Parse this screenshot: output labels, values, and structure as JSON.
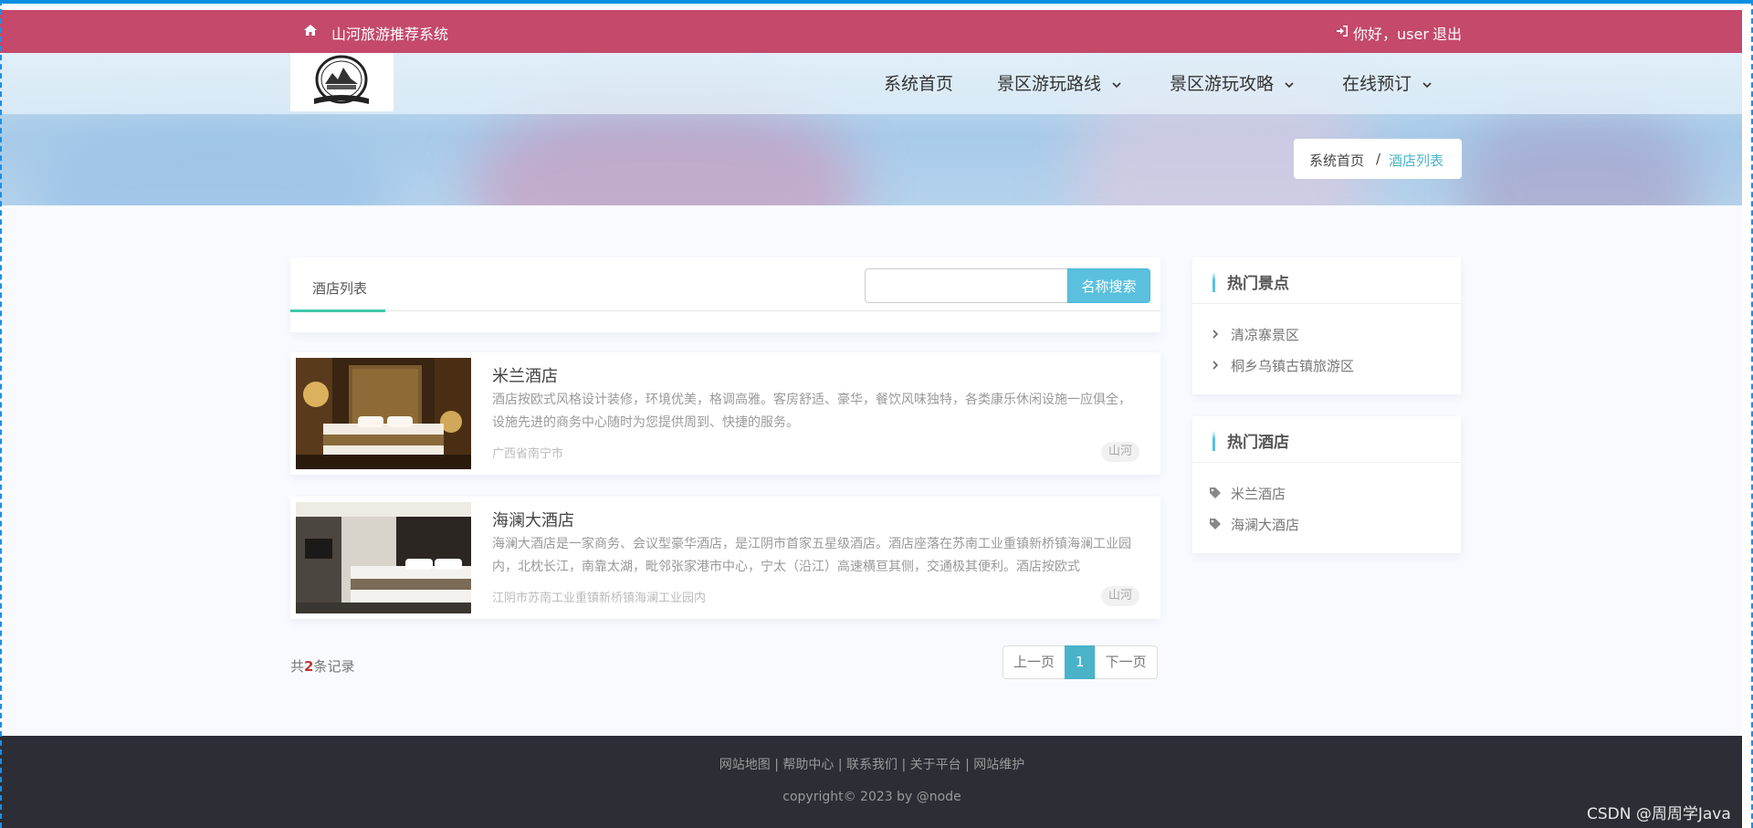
{
  "topbar": {
    "site_name": "山河旅游推荐系统",
    "greeting": "你好，user",
    "logout": "退出",
    "bg_color": "#c4496b"
  },
  "nav": {
    "items": [
      {
        "label": "系统首页",
        "has_dropdown": false
      },
      {
        "label": "景区游玩路线",
        "has_dropdown": true
      },
      {
        "label": "景区游玩攻略",
        "has_dropdown": true
      },
      {
        "label": "在线预订",
        "has_dropdown": true
      }
    ]
  },
  "breadcrumb": {
    "home": "系统首页",
    "separator": "/",
    "current": "酒店列表"
  },
  "list": {
    "tab_label": "酒店列表",
    "search_value": "",
    "search_button": "名称搜索",
    "accent_color": "#3fc8a8",
    "hotels": [
      {
        "name": "米兰酒店",
        "description": "酒店按欧式风格设计装修，环境优美，格调高雅。客房舒适、豪华，餐饮风味独特，各类康乐休闲设施一应俱全，设施先进的商务中心随时为您提供周到、快捷的服务。",
        "address": "广西省南宁市",
        "tag": "山河"
      },
      {
        "name": "海澜大酒店",
        "description": "海澜大酒店是一家商务、会议型豪华酒店，是江阴市首家五星级酒店。酒店座落在苏南工业重镇新桥镇海澜工业园内，北枕长江，南靠太湖，毗邻张家港市中心，宁太（沿江）高速横亘其侧，交通极其便利。酒店按欧式",
        "address": "江阴市苏南工业重镇新桥镇海澜工业园内",
        "tag": "山河"
      }
    ],
    "count_prefix": "共",
    "count_value": "2",
    "count_suffix": "条记录",
    "pager": {
      "prev": "上一页",
      "current": "1",
      "next": "下一页",
      "active_color": "#4ab3c9"
    }
  },
  "sidebar": {
    "hot_spots": {
      "title": "热门景点",
      "items": [
        "清凉寨景区",
        "桐乡乌镇古镇旅游区"
      ]
    },
    "hot_hotels": {
      "title": "热门酒店",
      "items": [
        "米兰酒店",
        "海澜大酒店"
      ]
    }
  },
  "footer": {
    "links": [
      "网站地图",
      "帮助中心",
      "联系我们",
      "关于平台",
      "网站维护"
    ],
    "separator": " | ",
    "copyright": "copyright© 2023 by @node",
    "bg_color": "#2c2d35"
  },
  "watermark": "CSDN @周周学Java"
}
